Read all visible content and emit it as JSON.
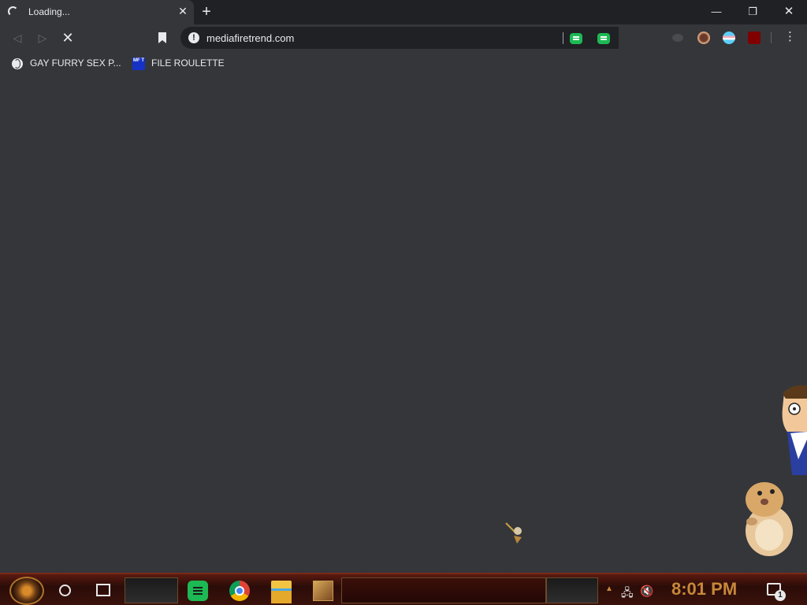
{
  "tab": {
    "title": "Loading...",
    "close_glyph": "✕"
  },
  "new_tab_glyph": "+",
  "window": {
    "minimize": "—",
    "restore": "❐",
    "close": "✕"
  },
  "nav": {
    "back": "◁",
    "forward": "▷",
    "stop": "✕"
  },
  "omnibox": {
    "info_glyph": "!",
    "url": "mediafiretrend.com"
  },
  "toolbar": {
    "menu_glyph": "⋮"
  },
  "bookmarks": [
    {
      "label": "GAY FURRY SEX P...",
      "icon": "globe-icon"
    },
    {
      "label": "FILE ROULETTE",
      "icon": "mft-icon",
      "icon_text": "MF T"
    }
  ],
  "taskbar": {
    "apps": [
      "spotify",
      "chrome",
      "file-explorer",
      "game"
    ],
    "clock": "8:01 PM",
    "notification_count": "1"
  }
}
